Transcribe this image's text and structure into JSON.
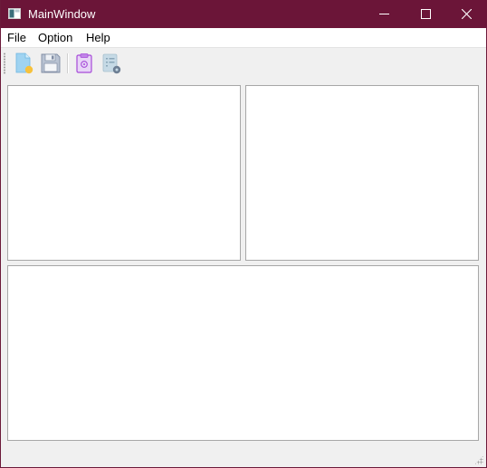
{
  "window": {
    "title": "MainWindow",
    "titlebar_color": "#6b1538"
  },
  "menubar": {
    "items": [
      {
        "label": "File"
      },
      {
        "label": "Option"
      },
      {
        "label": "Help"
      }
    ]
  },
  "toolbar": {
    "buttons": [
      {
        "icon": "new-file-icon"
      },
      {
        "icon": "save-icon"
      },
      {
        "icon": "clipboard-icon"
      },
      {
        "icon": "settings-list-icon"
      }
    ]
  },
  "panels": [
    {
      "name": "top-left"
    },
    {
      "name": "top-right"
    },
    {
      "name": "bottom"
    }
  ]
}
